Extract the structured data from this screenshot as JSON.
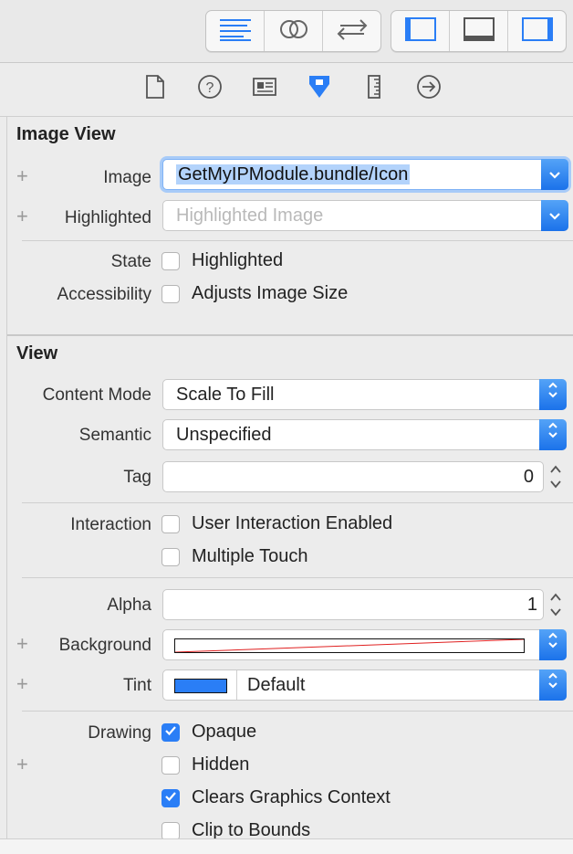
{
  "toolbar": {
    "editor_icons": [
      "standard-editor-icon",
      "assistant-editor-icon",
      "version-editor-icon"
    ],
    "view_icons": [
      "navigator-panel-icon",
      "debug-area-icon",
      "utilities-panel-icon"
    ],
    "accent": "#2a7ef6"
  },
  "inspector_tabs": [
    "file-inspector-icon",
    "quick-help-icon",
    "identity-inspector-icon",
    "attributes-inspector-icon",
    "size-inspector-icon",
    "connections-inspector-icon"
  ],
  "image_view": {
    "title": "Image View",
    "image": {
      "label": "Image",
      "value": "GetMyIPModule.bundle/Icon"
    },
    "highlighted": {
      "label": "Highlighted",
      "placeholder": "Highlighted Image"
    },
    "state": {
      "label": "State",
      "option": "Highlighted",
      "checked": false
    },
    "accessibility": {
      "label": "Accessibility",
      "option": "Adjusts Image Size",
      "checked": false
    }
  },
  "view": {
    "title": "View",
    "content_mode": {
      "label": "Content Mode",
      "value": "Scale To Fill"
    },
    "semantic": {
      "label": "Semantic",
      "value": "Unspecified"
    },
    "tag": {
      "label": "Tag",
      "value": "0"
    },
    "interaction": {
      "label": "Interaction",
      "options": [
        {
          "text": "User Interaction Enabled",
          "checked": false
        },
        {
          "text": "Multiple Touch",
          "checked": false
        }
      ]
    },
    "alpha": {
      "label": "Alpha",
      "value": "1"
    },
    "background": {
      "label": "Background"
    },
    "tint": {
      "label": "Tint",
      "value": "Default",
      "color": "#2a7ef6"
    },
    "drawing": {
      "label": "Drawing",
      "options": [
        {
          "text": "Opaque",
          "checked": true
        },
        {
          "text": "Hidden",
          "checked": false
        },
        {
          "text": "Clears Graphics Context",
          "checked": true
        },
        {
          "text": "Clip to Bounds",
          "checked": false
        }
      ]
    }
  }
}
